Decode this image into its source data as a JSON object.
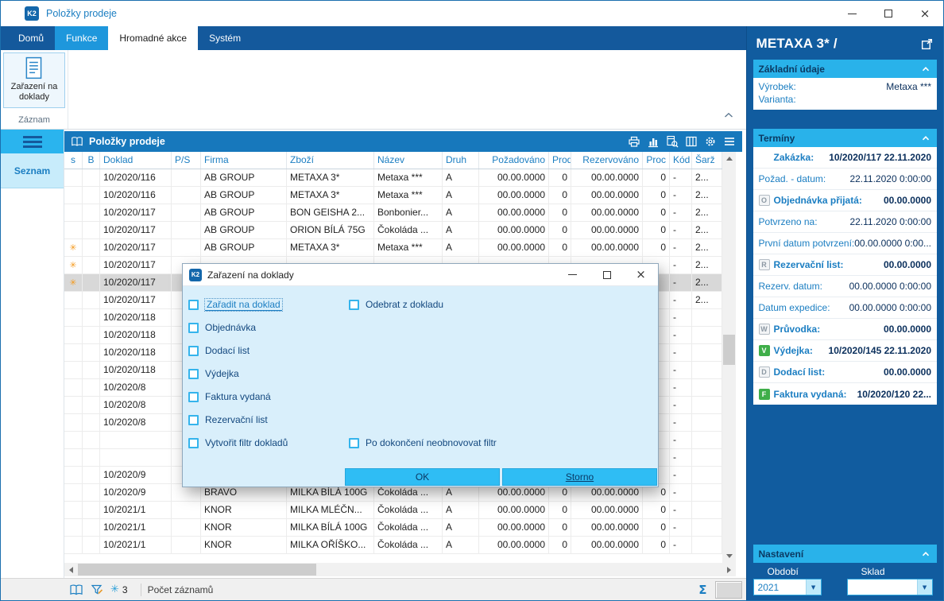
{
  "icons": {
    "close_glyph": "×",
    "sigma_glyph": "Σ",
    "star_glyph": "✳",
    "dropdown_glyph": "▼"
  },
  "window": {
    "title": "Položky prodeje",
    "logo": "K2"
  },
  "tabs": [
    {
      "label": "Domů",
      "cls": ""
    },
    {
      "label": "Funkce",
      "cls": "accent"
    },
    {
      "label": "Hromadné akce",
      "cls": "active"
    },
    {
      "label": "Systém",
      "cls": ""
    }
  ],
  "ribbon": {
    "button_label": "Zařazení na doklady",
    "group_label": "Záznam"
  },
  "sidebar": {
    "label": "Seznam"
  },
  "table": {
    "title": "Položky prodeje",
    "columns": [
      {
        "label": "s",
        "cls": "center"
      },
      {
        "label": "B",
        "cls": "center"
      },
      {
        "label": "Doklad",
        "cls": ""
      },
      {
        "label": "P/S",
        "cls": ""
      },
      {
        "label": "Firma",
        "cls": ""
      },
      {
        "label": "Zboží",
        "cls": ""
      },
      {
        "label": "Název",
        "cls": ""
      },
      {
        "label": "Druh",
        "cls": ""
      },
      {
        "label": "Požadováno",
        "cls": "num"
      },
      {
        "label": "Prodl.",
        "cls": "num"
      },
      {
        "label": "Rezervováno",
        "cls": "num"
      },
      {
        "label": "Proc",
        "cls": "num"
      },
      {
        "label": "Kód",
        "cls": ""
      },
      {
        "label": "Šarž",
        "cls": ""
      }
    ],
    "rows": [
      {
        "doklad": "10/2020/116",
        "firma": "AB GROUP",
        "zbozi": "METAXA 3*",
        "nazev": "Metaxa ***",
        "druh": "A",
        "poz": "00.00.0000",
        "prodl": "0",
        "rez": "00.00.0000",
        "proc": "0",
        "kod": "-",
        "sarz": "2..."
      },
      {
        "doklad": "10/2020/116",
        "firma": "AB GROUP",
        "zbozi": "METAXA 3*",
        "nazev": "Metaxa ***",
        "druh": "A",
        "poz": "00.00.0000",
        "prodl": "0",
        "rez": "00.00.0000",
        "proc": "0",
        "kod": "-",
        "sarz": "2..."
      },
      {
        "doklad": "10/2020/117",
        "firma": "AB GROUP",
        "zbozi": "BON GEISHA 2...",
        "nazev": "Bonbonier...",
        "druh": "A",
        "poz": "00.00.0000",
        "prodl": "0",
        "rez": "00.00.0000",
        "proc": "0",
        "kod": "-",
        "sarz": "2..."
      },
      {
        "doklad": "10/2020/117",
        "firma": "AB GROUP",
        "zbozi": "ORION BÍLÁ 75G",
        "nazev": "Čokoláda ...",
        "druh": "A",
        "poz": "00.00.0000",
        "prodl": "0",
        "rez": "00.00.0000",
        "proc": "0",
        "kod": "-",
        "sarz": "2..."
      },
      {
        "s": "✳",
        "doklad": "10/2020/117",
        "firma": "AB GROUP",
        "zbozi": "METAXA 3*",
        "nazev": "Metaxa ***",
        "druh": "A",
        "poz": "00.00.0000",
        "prodl": "0",
        "rez": "00.00.0000",
        "proc": "0",
        "kod": "-",
        "sarz": "2..."
      },
      {
        "s": "✳",
        "doklad": "10/2020/117",
        "kod": "-",
        "sarz": "2..."
      },
      {
        "s": "✳",
        "doklad": "10/2020/117",
        "kod": "-",
        "sarz": "2...",
        "cls": "selected"
      },
      {
        "doklad": "10/2020/117",
        "kod": "-",
        "sarz": "2..."
      },
      {
        "doklad": "10/2020/118",
        "kod": "-"
      },
      {
        "doklad": "10/2020/118",
        "kod": "-"
      },
      {
        "doklad": "10/2020/118",
        "kod": "-"
      },
      {
        "doklad": "10/2020/118",
        "kod": "-"
      },
      {
        "doklad": "10/2020/8",
        "kod": "-"
      },
      {
        "doklad": "10/2020/8",
        "kod": "-"
      },
      {
        "doklad": "10/2020/8",
        "kod": "-"
      },
      {
        "doklad": "",
        "kod": "-"
      },
      {
        "doklad": "",
        "kod": "-"
      },
      {
        "doklad": "10/2020/9",
        "kod": "-"
      },
      {
        "doklad": "10/2020/9",
        "firma": "BRAVO",
        "zbozi": "MILKA BÍLÁ 100G",
        "nazev": "Čokoláda ...",
        "druh": "A",
        "poz": "00.00.0000",
        "prodl": "0",
        "rez": "00.00.0000",
        "proc": "0",
        "kod": "-"
      },
      {
        "doklad": "10/2021/1",
        "firma": "KNOR",
        "zbozi": "MILKA MLÉČN...",
        "nazev": "Čokoláda ...",
        "druh": "A",
        "poz": "00.00.0000",
        "prodl": "0",
        "rez": "00.00.0000",
        "proc": "0",
        "kod": "-"
      },
      {
        "doklad": "10/2021/1",
        "firma": "KNOR",
        "zbozi": "MILKA BÍLÁ 100G",
        "nazev": "Čokoláda ...",
        "druh": "A",
        "poz": "00.00.0000",
        "prodl": "0",
        "rez": "00.00.0000",
        "proc": "0",
        "kod": "-"
      },
      {
        "doklad": "10/2021/1",
        "firma": "KNOR",
        "zbozi": "MILKA OŘÍŠKO...",
        "nazev": "Čokoláda ...",
        "druh": "A",
        "poz": "00.00.0000",
        "prodl": "0",
        "rez": "00.00.0000",
        "proc": "0",
        "kod": "-"
      }
    ]
  },
  "dialog": {
    "title": "Zařazení na doklady",
    "checks": [
      "Zařadit na doklad",
      "Odebrat z dokladu",
      "Objednávka",
      "Dodací list",
      "Výdejka",
      "Faktura vydaná",
      "Rezervační list",
      "Vytvořit filtr dokladů",
      "Po dokončení neobnovovat filtr"
    ],
    "ok_label": "OK",
    "storno_label": "Storno"
  },
  "panel": {
    "title": "METAXA 3* /",
    "zakladni": {
      "title": "Základní údaje",
      "fields": [
        {
          "label": "Výrobek:",
          "value": "Metaxa ***"
        },
        {
          "label": "Varianta:",
          "value": ""
        }
      ]
    },
    "terminy": {
      "title": "Termíny",
      "fields": [
        {
          "badge": "",
          "badge_cls": "",
          "label": "Zakázka:",
          "value": "10/2020/117 22.11.2020",
          "cls": "strong indent"
        },
        {
          "badge": "",
          "badge_cls": "",
          "label": "Požad. - datum:",
          "value": "22.11.2020 0:00:00",
          "cls": ""
        },
        {
          "badge": "O",
          "badge_cls": "gray",
          "label": "Objednávka přijatá:",
          "value": "00.00.0000",
          "cls": "strong"
        },
        {
          "badge": "",
          "badge_cls": "",
          "label": "Potvrzeno na:",
          "value": "22.11.2020 0:00:00",
          "cls": ""
        },
        {
          "badge": "",
          "badge_cls": "",
          "label": "První datum potvrzení:",
          "value": "00.00.0000 0:00...",
          "cls": ""
        },
        {
          "badge": "R",
          "badge_cls": "gray",
          "label": "Rezervační list:",
          "value": "00.00.0000",
          "cls": "strong"
        },
        {
          "badge": "",
          "badge_cls": "",
          "label": "Rezerv. datum:",
          "value": "00.00.0000 0:00:00",
          "cls": ""
        },
        {
          "badge": "",
          "badge_cls": "",
          "label": "Datum expedice:",
          "value": "00.00.0000 0:00:00",
          "cls": ""
        },
        {
          "badge": "W",
          "badge_cls": "gray",
          "label": "Průvodka:",
          "value": "00.00.0000",
          "cls": "strong"
        },
        {
          "badge": "V",
          "badge_cls": "green",
          "label": "Výdejka:",
          "value": "10/2020/145 22.11.2020",
          "cls": "strong"
        },
        {
          "badge": "D",
          "badge_cls": "gray",
          "label": "Dodací list:",
          "value": "00.00.0000",
          "cls": "strong"
        },
        {
          "badge": "F",
          "badge_cls": "green",
          "label": "Faktura vydaná:",
          "value": "10/2020/120 22...",
          "cls": "strong"
        }
      ]
    },
    "nastaveni": {
      "title": "Nastavení",
      "obdobi_label": "Období",
      "obdobi_value": "2021",
      "sklad_label": "Sklad",
      "sklad_value": ""
    }
  },
  "statusbar": {
    "count": "3",
    "records_label": "Počet záznamů"
  }
}
